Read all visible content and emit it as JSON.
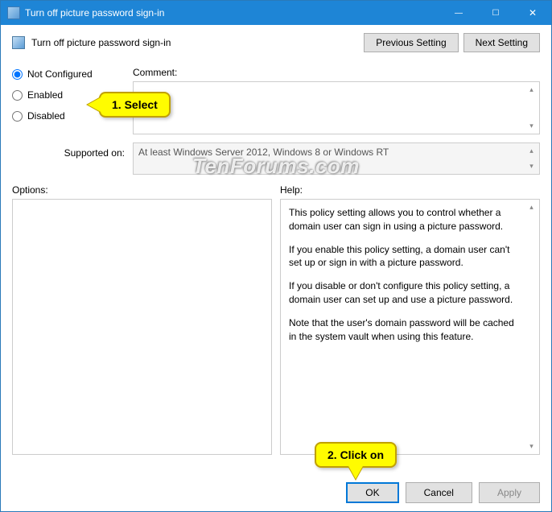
{
  "window": {
    "title": "Turn off picture password sign-in",
    "minimize": "—",
    "maximize": "☐",
    "close": "✕"
  },
  "header": {
    "policy_title": "Turn off picture password sign-in",
    "prev": "Previous Setting",
    "next": "Next Setting"
  },
  "radios": {
    "not_configured": "Not Configured",
    "enabled": "Enabled",
    "disabled": "Disabled"
  },
  "labels": {
    "comment": "Comment:",
    "supported": "Supported on:",
    "options": "Options:",
    "help": "Help:"
  },
  "supported_text": "At least Windows Server 2012, Windows 8 or Windows RT",
  "help_text": {
    "p1": "This policy setting allows you to control whether a domain user can sign in using a picture password.",
    "p2": "If you enable this policy setting, a domain user can't set up or sign in with a picture password.",
    "p3": "If you disable or don't configure this policy setting, a domain user can set up and use a picture password.",
    "p4": "Note that the user's domain password will be cached in the system vault when using this feature."
  },
  "footer": {
    "ok": "OK",
    "cancel": "Cancel",
    "apply": "Apply"
  },
  "callouts": {
    "c1": "1. Select",
    "c2": "2. Click on"
  },
  "watermark": "TenForums.com"
}
